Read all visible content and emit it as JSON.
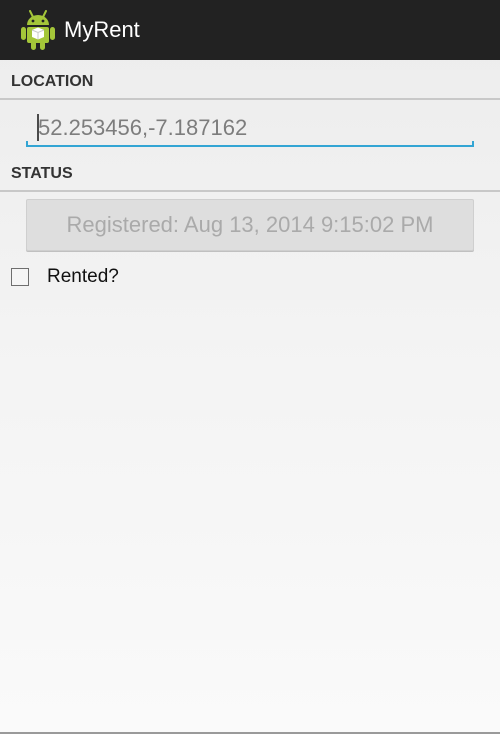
{
  "action_bar": {
    "title": "MyRent",
    "icon": "android-robot-icon",
    "background_color": "#222222"
  },
  "location_section": {
    "header": "LOCATION",
    "field_value": "52.253456,-7.187162",
    "accent_color": "#33a5d4"
  },
  "status_section": {
    "header": "STATUS",
    "date_button_label": "Registered: Aug 13, 2014 9:15:02 PM"
  },
  "rented": {
    "label": "Rented?",
    "checked": false
  }
}
